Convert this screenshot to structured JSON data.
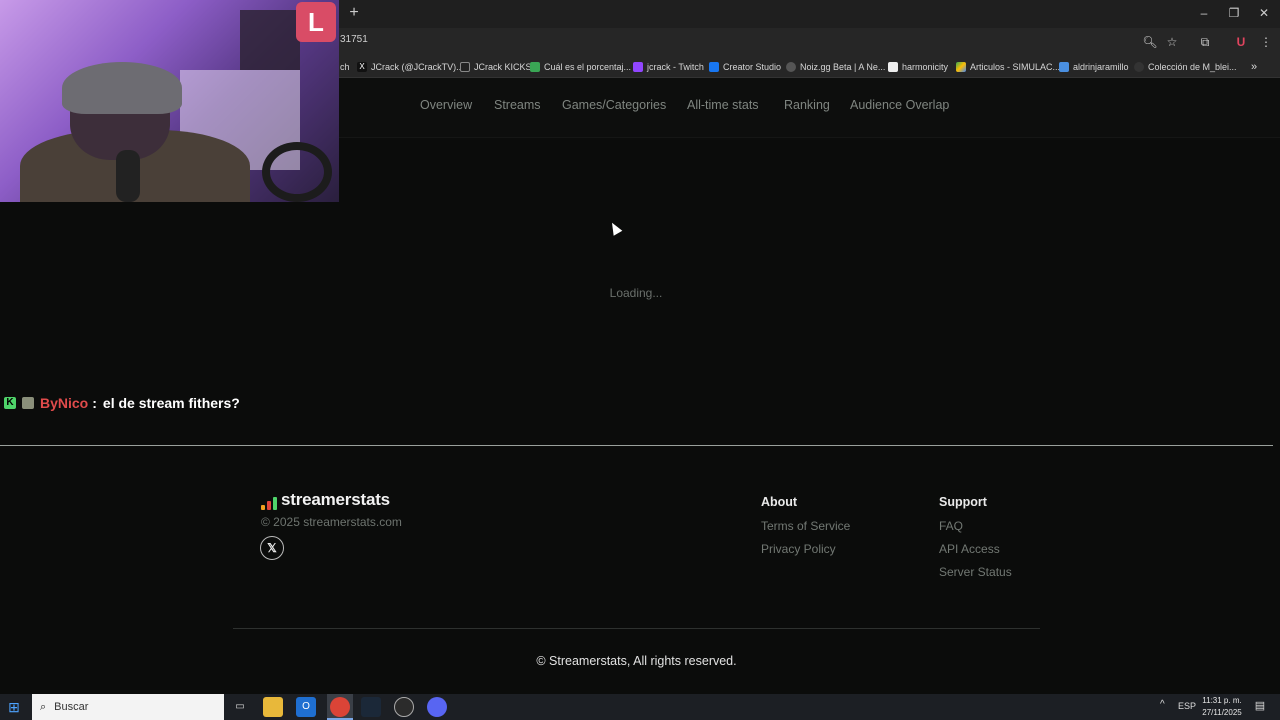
{
  "browser": {
    "new_tab_glyph": "+",
    "url": "31751",
    "window_controls": [
      "–",
      "❐",
      "✕"
    ],
    "bookmarks": [
      {
        "label": "ch",
        "icon": "none"
      },
      {
        "label": "JCrack (@JCrackTV)...",
        "icon": "x-icon"
      },
      {
        "label": "JCrack KICKS",
        "icon": "kick-icon"
      },
      {
        "label": "Cuál es el porcentaj...",
        "icon": "green-icon"
      },
      {
        "label": "jcrack - Twitch",
        "icon": "twitch-icon"
      },
      {
        "label": "Creator Studio",
        "icon": "facebook-icon"
      },
      {
        "label": "Noiz.gg Beta | A Ne...",
        "icon": "noiz-icon"
      },
      {
        "label": "harmonicity",
        "icon": "doc-icon"
      },
      {
        "label": "Articulos - SIMULAC...",
        "icon": "drive-icon"
      },
      {
        "label": "aldrinjaramillo",
        "icon": "blue-icon"
      },
      {
        "label": "Colección de M_blei...",
        "icon": "globe-icon"
      }
    ],
    "more_bookmarks": "»"
  },
  "site_nav": {
    "links": [
      "Overview",
      "Streams",
      "Games/Categories",
      "All-time stats",
      "Ranking",
      "Audience Overlap"
    ]
  },
  "main": {
    "loading_text": "Loading..."
  },
  "overlay": {
    "webcam_sign": "L",
    "chat": {
      "username": "ByNico",
      "separator": ":",
      "message": "el de stream fithers?",
      "username_color": "#e04b4b"
    }
  },
  "footer": {
    "brand": "streamerstats",
    "copyright_small": "© 2025 streamerstats.com",
    "x_glyph": "𝕏",
    "about": {
      "heading": "About",
      "links": [
        "Terms of Service",
        "Privacy Policy"
      ]
    },
    "support": {
      "heading": "Support",
      "links": [
        "FAQ",
        "API Access",
        "Server Status"
      ]
    },
    "rights": "© Streamerstats, All rights reserved."
  },
  "taskbar": {
    "search_placeholder": "Buscar",
    "language": "ESP",
    "time": "11:31 p. m.",
    "date": "27/11/2025"
  },
  "colors": {
    "accent_green": "#4fd46a",
    "bar_orange": "#f0a020",
    "bar_red": "#e0443a"
  }
}
